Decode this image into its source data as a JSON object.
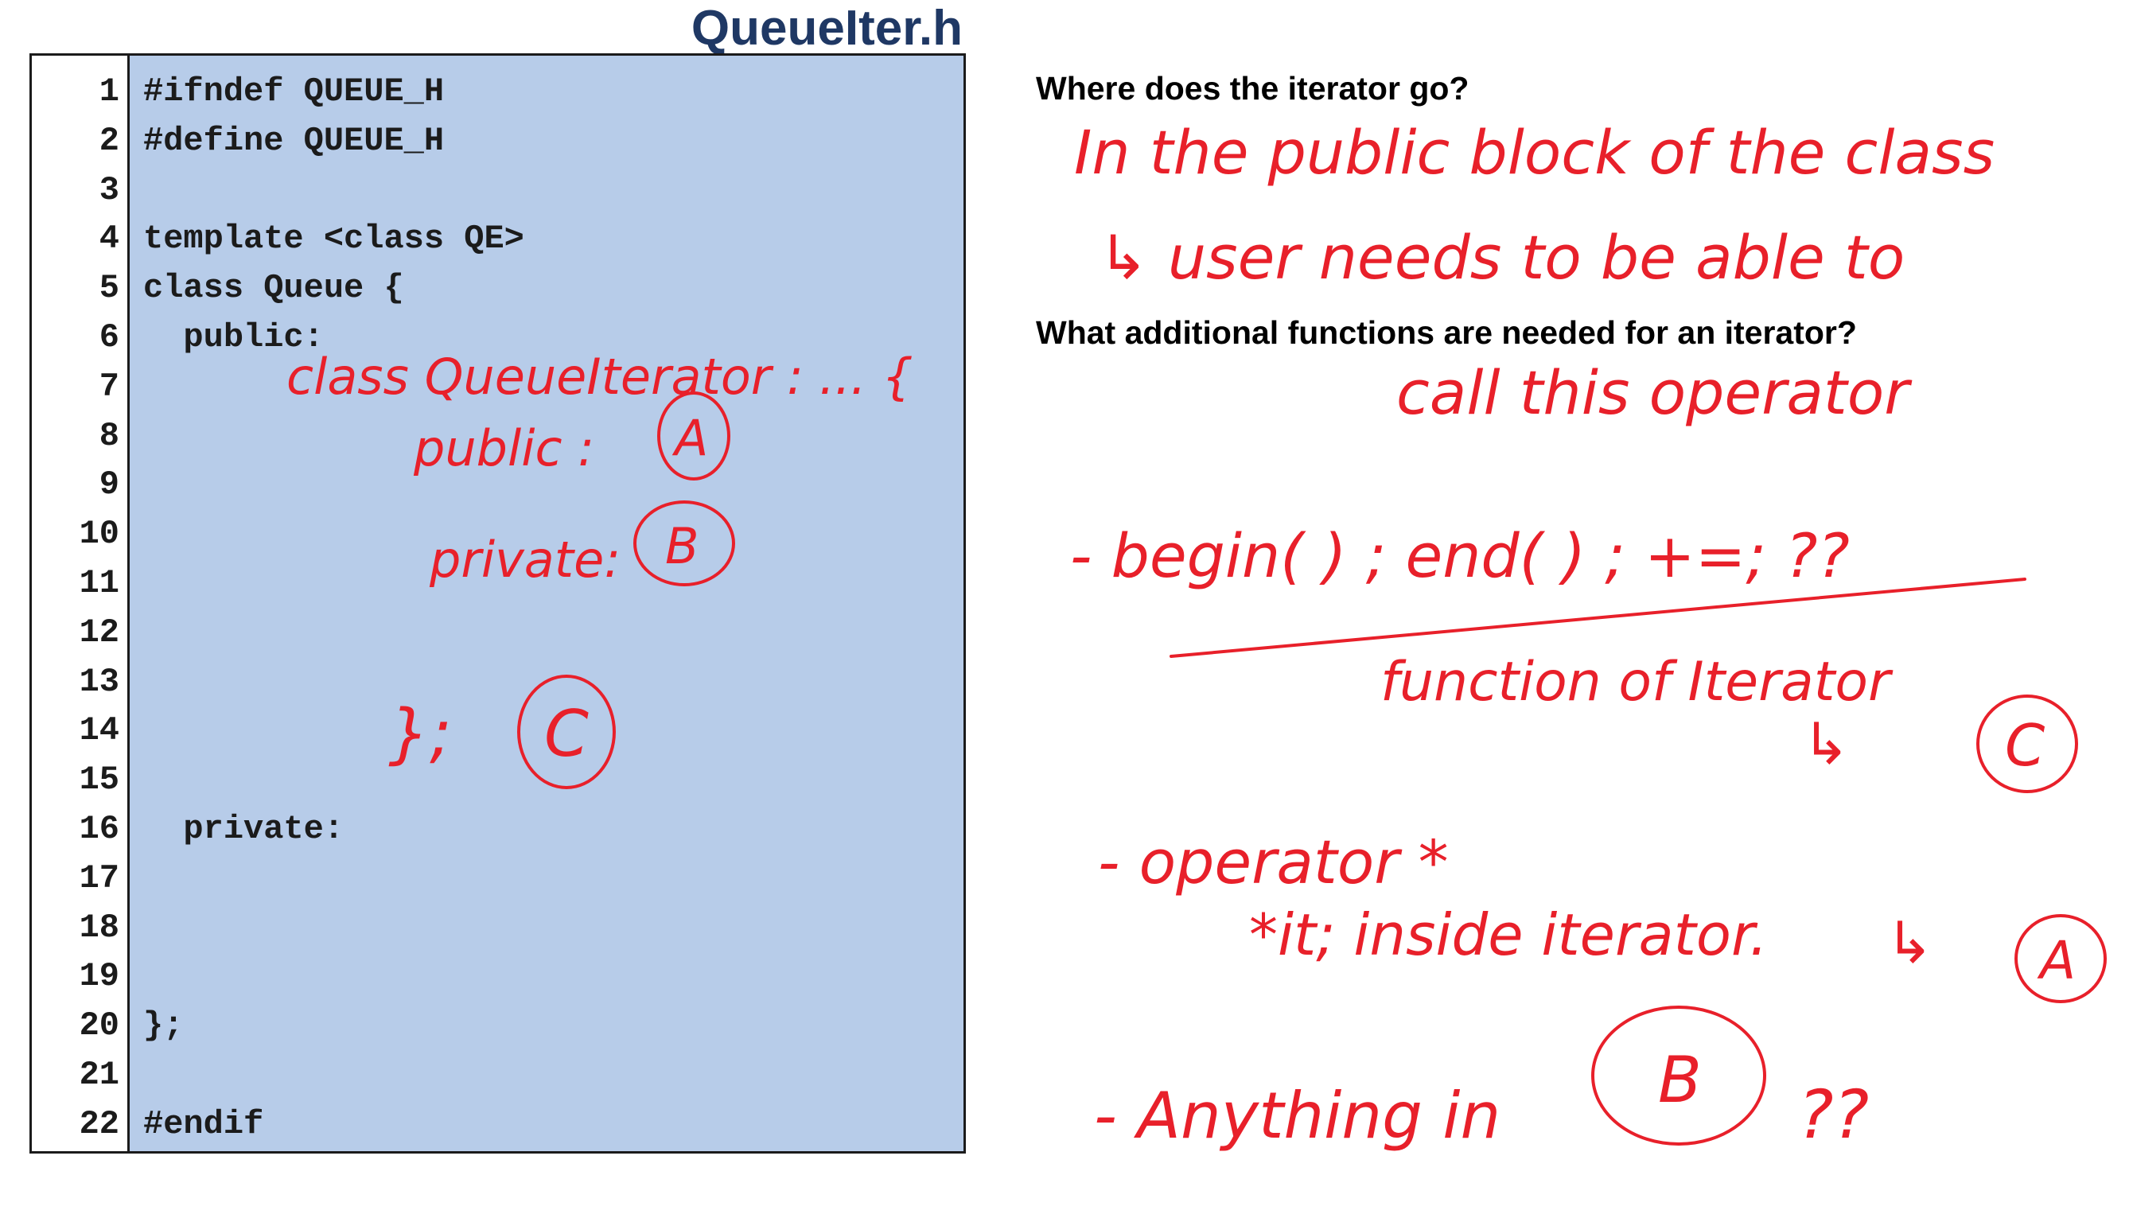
{
  "slide": {
    "title": "QueueIter.h"
  },
  "code": {
    "lines": [
      {
        "num": "1",
        "text": "#ifndef QUEUE_H"
      },
      {
        "num": "2",
        "text": "#define QUEUE_H"
      },
      {
        "num": "3",
        "text": ""
      },
      {
        "num": "4",
        "text": "template <class QE>"
      },
      {
        "num": "5",
        "text": "class Queue {"
      },
      {
        "num": "6",
        "text": "  public:"
      },
      {
        "num": "7",
        "text": ""
      },
      {
        "num": "8",
        "text": ""
      },
      {
        "num": "9",
        "text": ""
      },
      {
        "num": "10",
        "text": ""
      },
      {
        "num": "11",
        "text": ""
      },
      {
        "num": "12",
        "text": ""
      },
      {
        "num": "13",
        "text": ""
      },
      {
        "num": "14",
        "text": ""
      },
      {
        "num": "15",
        "text": ""
      },
      {
        "num": "16",
        "text": "  private:"
      },
      {
        "num": "17",
        "text": ""
      },
      {
        "num": "18",
        "text": ""
      },
      {
        "num": "19",
        "text": ""
      },
      {
        "num": "20",
        "text": "};"
      },
      {
        "num": "21",
        "text": ""
      },
      {
        "num": "22",
        "text": "#endif"
      }
    ]
  },
  "questions": {
    "q1": "Where does the iterator go?",
    "q2": "What additional functions are needed for an iterator?"
  },
  "handwriting": {
    "code_annotations": {
      "nested_class": "class QueueIterator : ... {",
      "public_label": "public :",
      "mark_a": "A",
      "private_label": "private:",
      "mark_b": "B",
      "closing": "};",
      "mark_c": "C"
    },
    "answer1": {
      "line1": "In the public block of the class",
      "line2": "↳ user needs to be able to",
      "line3": "call this operator"
    },
    "answer2": {
      "item1": "- begin( ) ; end( ) ;  +=; ??",
      "item1_note": "function of Iterator",
      "item1_arrow": "↳",
      "item1_mark": "C",
      "item2": "- operator *",
      "item2_note": "*it; inside iterator.",
      "item2_arrow": "↳",
      "item2_mark": "A",
      "item3_prefix": "- Anything  in",
      "item3_mark": "B",
      "item3_suffix": "??"
    },
    "ink_color": "#e8202a"
  }
}
